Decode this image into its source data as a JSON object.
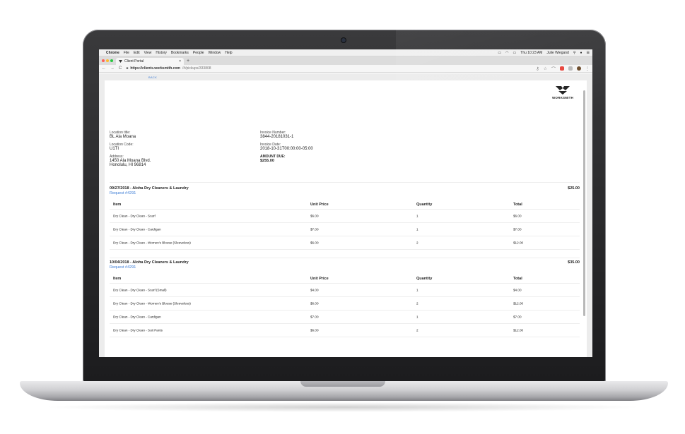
{
  "menubar": {
    "app": "Chrome",
    "menus": [
      "File",
      "Edit",
      "View",
      "History",
      "Bookmarks",
      "People",
      "Window",
      "Help"
    ],
    "clock": "Thu 10:23 AM",
    "user": "Julie Wiegand"
  },
  "tab": {
    "title": "Client Portal",
    "new_tab": "+"
  },
  "address": {
    "host": "https://clients.worksmith.com",
    "path": "/#/pickups/333808"
  },
  "page": {
    "back_label": "BACK",
    "logo_text": "WORKSMITH",
    "location_title_label": "Location title:",
    "location_title": "BL Ala Moana",
    "location_code_label": "Location Code:",
    "location_code": "U1TI",
    "address_label": "Address:",
    "address_line1": "1450 Ala Moana Blvd.",
    "address_line2": "Honolulu, HI 96814",
    "invoice_number_label": "Invoice Number:",
    "invoice_number": "3844-20181031-1",
    "invoice_date_label": "Invoice Date:",
    "invoice_date": "2018-10-31T00:00:00-05:00",
    "amount_due_label": "AMOUNT DUE:",
    "amount_due": "$255.00"
  },
  "table_headers": {
    "item": "Item",
    "unit_price": "Unit Price",
    "quantity": "Quantity",
    "total": "Total"
  },
  "groups": [
    {
      "title": "09/27/2018 - Aloha Dry Cleaners & Laundry",
      "request": "Request #4291",
      "amount": "$25.00",
      "rows": [
        {
          "item": "Dry Clean - Dry Clean - Scarf",
          "unit_price": "$6.00",
          "quantity": "1",
          "total": "$6.00"
        },
        {
          "item": "Dry Clean - Dry Clean - Cardigan",
          "unit_price": "$7.00",
          "quantity": "1",
          "total": "$7.00"
        },
        {
          "item": "Dry Clean - Dry Clean - Women's Blouse (Sleeveless)",
          "unit_price": "$6.00",
          "quantity": "2",
          "total": "$12.00"
        }
      ]
    },
    {
      "title": "10/04/2018 - Aloha Dry Cleaners & Laundry",
      "request": "Request #4291",
      "amount": "$35.00",
      "rows": [
        {
          "item": "Dry Clean - Dry Clean - Scarf (Small)",
          "unit_price": "$4.00",
          "quantity": "1",
          "total": "$4.00"
        },
        {
          "item": "Dry Clean - Dry Clean - Women's Blouse (Sleeveless)",
          "unit_price": "$6.00",
          "quantity": "2",
          "total": "$12.00"
        },
        {
          "item": "Dry Clean - Dry Clean - Cardigan",
          "unit_price": "$7.00",
          "quantity": "1",
          "total": "$7.00"
        },
        {
          "item": "Dry Clean - Dry Clean - Suit Pants",
          "unit_price": "$6.00",
          "quantity": "2",
          "total": "$12.00"
        }
      ]
    }
  ],
  "colors": {
    "link": "#3a7bd5",
    "close_dot": "#ff5f57",
    "min_dot": "#febc2e",
    "max_dot": "#28c840"
  }
}
